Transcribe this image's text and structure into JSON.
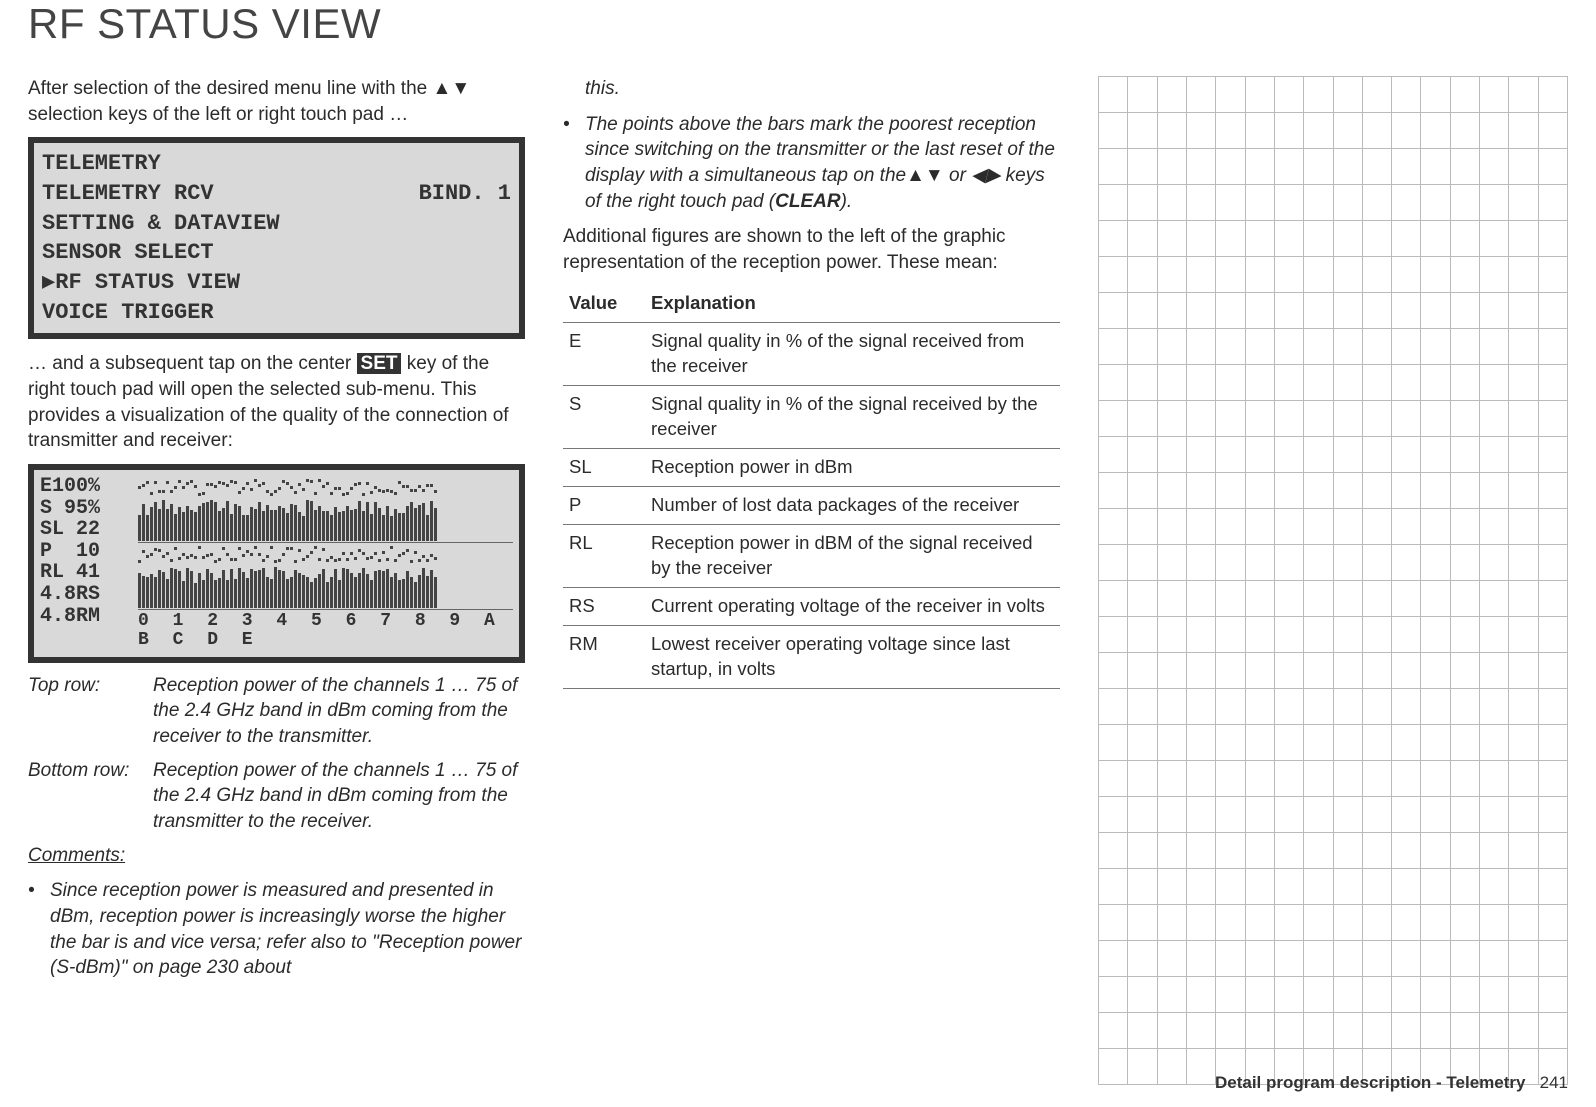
{
  "title": "RF STATUS VIEW",
  "col1": {
    "intro_before": "After selection of the desired menu line with the ",
    "intro_arrows": "▲▼",
    "intro_after": " selection keys of the left or right touch pad …",
    "menu": {
      "l1": "TELEMETRY",
      "l2a": "TELEMETRY RCV",
      "l2b": "BIND. 1",
      "l3": "SETTING & DATAVIEW",
      "l4": "SENSOR SELECT",
      "l5": "▶RF STATUS VIEW",
      "l6": "VOICE TRIGGER"
    },
    "mid_before": "… and a subsequent tap on the center ",
    "mid_set": "SET",
    "mid_after": " key of the right touch pad will open the selected sub-menu. This provides a visualization of the quality of the connection of transmitter and receiver:",
    "rf": {
      "e": "E100%",
      "s": "S 95%",
      "sl": "SL 22",
      "p": "P  10",
      "rl": "RL 41",
      "rs": "4.8RS",
      "rm": "4.8RM",
      "axis": "0 1 2 3 4 5 6 7 8 9 A B C D E"
    },
    "top_label": "Top row:",
    "top_text": "Reception power of the channels 1 … 75 of the 2.4 GHz band in dBm coming from the receiver to the transmitter.",
    "bottom_label": "Bottom row:",
    "bottom_text": "Reception power of the channels 1 … 75 of the 2.4 GHz band in dBm coming from the transmitter to the receiver.",
    "comments_head": "Comments:",
    "comment1": "Since reception power is measured and presented in dBm, reception power is increasingly worse the higher the bar is and vice versa; refer also to \"Reception power (S-dBm)\" on page 230 about"
  },
  "col2": {
    "cont": "this.",
    "bullet2_before": "The points above the bars mark the poorest reception since switching on the transmitter or the last reset of the display with a simultaneous tap on the",
    "bullet2_arrows1": "▲▼",
    "bullet2_or": " or ",
    "bullet2_arrows2": "◀▶",
    "bullet2_after": " keys of the right touch pad (",
    "bullet2_clear": "CLEAR",
    "bullet2_end": ").",
    "intro2": "Additional figures are shown to the left of the graphic representation of the reception power. These mean:",
    "th1": "Value",
    "th2": "Explanation",
    "rows": [
      {
        "v": "E",
        "e": "Signal quality in % of the signal received from the receiver"
      },
      {
        "v": "S",
        "e": "Signal quality in % of the signal received by the receiver"
      },
      {
        "v": "SL",
        "e": "Reception power in dBm"
      },
      {
        "v": "P",
        "e": "Number of lost data packages of the receiver"
      },
      {
        "v": "RL",
        "e": "Reception power in dBM of the signal received by the receiver"
      },
      {
        "v": "RS",
        "e": "Current operating voltage of the receiver in volts"
      },
      {
        "v": "RM",
        "e": "Lowest receiver operating voltage since last startup, in volts"
      }
    ]
  },
  "footer": {
    "text": "Detail program description - Telemetry",
    "page": "241"
  }
}
